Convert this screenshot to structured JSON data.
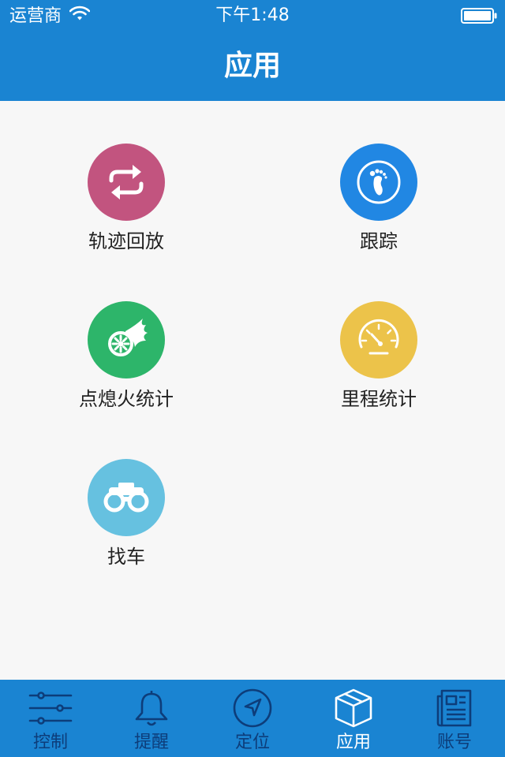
{
  "status_bar": {
    "carrier": "运营商",
    "time": "下午1:48",
    "wifi_icon": "wifi-icon",
    "battery_icon": "battery-icon"
  },
  "header": {
    "title": "应用"
  },
  "apps": [
    {
      "label": "轨迹回放",
      "icon": "replay-arrows-icon",
      "color": "#c2547f"
    },
    {
      "label": "跟踪",
      "icon": "footprint-icon",
      "color": "#2187e3"
    },
    {
      "label": "点熄火统计",
      "icon": "wheel-flame-icon",
      "color": "#2db56a"
    },
    {
      "label": "里程统计",
      "icon": "speedometer-icon",
      "color": "#ecc34a"
    },
    {
      "label": "找车",
      "icon": "binoculars-icon",
      "color": "#66c1e0"
    }
  ],
  "tabbar": {
    "tabs": [
      {
        "label": "控制",
        "icon": "sliders-icon",
        "active": false
      },
      {
        "label": "提醒",
        "icon": "bell-icon",
        "active": false
      },
      {
        "label": "定位",
        "icon": "navigation-icon",
        "active": false
      },
      {
        "label": "应用",
        "icon": "box-icon",
        "active": true
      },
      {
        "label": "账号",
        "icon": "newspaper-icon",
        "active": false
      }
    ],
    "active_color": "#ffffff",
    "inactive_color": "#0d3d7a"
  },
  "colors": {
    "accent": "#1a84d2",
    "background": "#f7f7f7"
  }
}
